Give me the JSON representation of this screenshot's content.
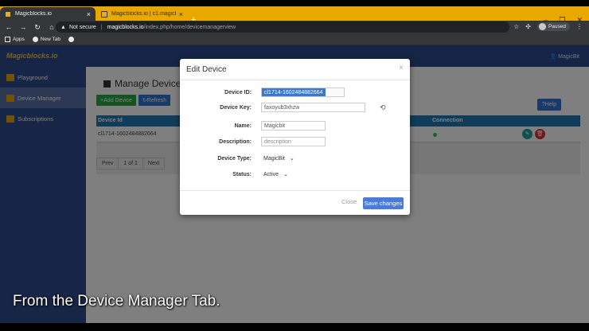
{
  "browser": {
    "tabs": [
      {
        "title": "Magicblocks.io",
        "close": "×"
      },
      {
        "title": "Magicblocks.io | c1.magicblocks",
        "close": "×"
      }
    ],
    "new_tab": "+",
    "window_controls": {
      "minimize": "–",
      "maximize": "❐",
      "close": "✕"
    },
    "nav": {
      "back": "←",
      "forward": "→",
      "reload": "↻",
      "home": "⌂"
    },
    "address": {
      "security": "Not secure",
      "separator": "|",
      "host": "magicblocks.io",
      "path": "/index.php/home/devicemanagerview"
    },
    "profile": "Paused",
    "bookmarks": [
      "Apps",
      "New Tab"
    ]
  },
  "app": {
    "logo": "Magicblocks.io",
    "user": "MagicBit",
    "sidebar": [
      {
        "label": "Playground"
      },
      {
        "label": "Device Manager"
      },
      {
        "label": "Subscriptions"
      }
    ],
    "page_title": "Manage Devices",
    "add_button": "+Add Device",
    "refresh_button": "Refresh",
    "help_button": "Help",
    "table": {
      "headers": [
        "Device Id",
        "Connection"
      ],
      "rows": [
        {
          "device_id": "cl1714-1602484882664"
        }
      ]
    },
    "pager": [
      "Prev",
      "1 of 1",
      "Next"
    ]
  },
  "modal": {
    "title": "Edit Device",
    "close": "×",
    "fields": {
      "device_id": {
        "label": "Device ID:",
        "value": "cl1714-1602484882664"
      },
      "device_key": {
        "label": "Device Key:",
        "value": "faxoyub3xhzw"
      },
      "name": {
        "label": "Name:",
        "value": "Magicbit"
      },
      "description": {
        "label": "Description:",
        "placeholder": "description"
      },
      "device_type": {
        "label": "Device Type:",
        "value": "MagicBit"
      },
      "status": {
        "label": "Status:",
        "value": "Active"
      }
    },
    "close_button": "Close",
    "save_button": "Save changes"
  },
  "caption": "From the Device Manager Tab."
}
